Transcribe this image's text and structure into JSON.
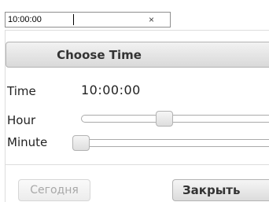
{
  "time_input": {
    "value": "10:00:00",
    "clear_label": "×"
  },
  "picker": {
    "title": "Choose Time",
    "time_label": "Time",
    "time_value": "10:00:00",
    "hour_label": "Hour",
    "minute_label": "Minute",
    "hour_value": 10,
    "minute_value": 0,
    "today_button": "Сегодня",
    "close_button": "Закрыть"
  }
}
